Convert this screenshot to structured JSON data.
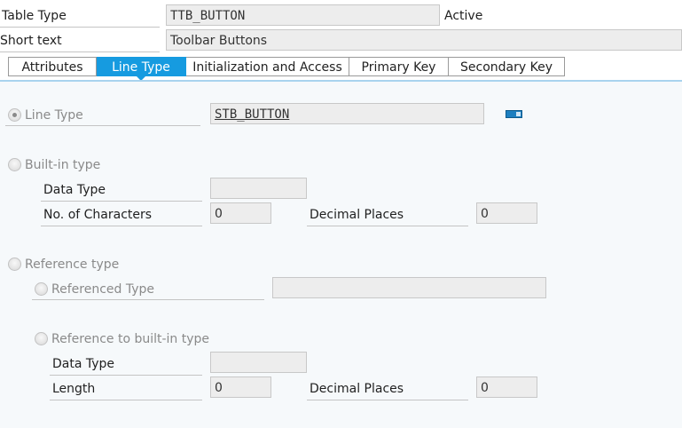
{
  "header": {
    "table_type_label": "Table Type",
    "table_type_value": "TTB_BUTTON",
    "status": "Active",
    "short_text_label": "Short text",
    "short_text_value": "Toolbar Buttons"
  },
  "tabs": [
    {
      "label": "Attributes",
      "active": false
    },
    {
      "label": "Line Type",
      "active": true
    },
    {
      "label": "Initialization and Access",
      "active": false
    },
    {
      "label": "Primary Key",
      "active": false
    },
    {
      "label": "Secondary Key",
      "active": false
    }
  ],
  "line_type": {
    "radio_label": "Line Type",
    "value": "STB_BUTTON",
    "selected": true
  },
  "builtin": {
    "radio_label": "Built-in type",
    "data_type_label": "Data Type",
    "data_type_value": "",
    "chars_label": "No. of Characters",
    "chars_value": "0",
    "decimal_label": "Decimal Places",
    "decimal_value": "0"
  },
  "reference": {
    "radio_label": "Reference type",
    "referenced_type_label": "Referenced Type",
    "referenced_type_value": "",
    "ref_builtin_label": "Reference to built-in type",
    "data_type_label": "Data Type",
    "data_type_value": "",
    "length_label": "Length",
    "length_value": "0",
    "decimal_label": "Decimal Places",
    "decimal_value": "0"
  },
  "colors": {
    "accent": "#169be0",
    "field_bg": "#ededed",
    "panel_bg": "#f6f9fb"
  }
}
